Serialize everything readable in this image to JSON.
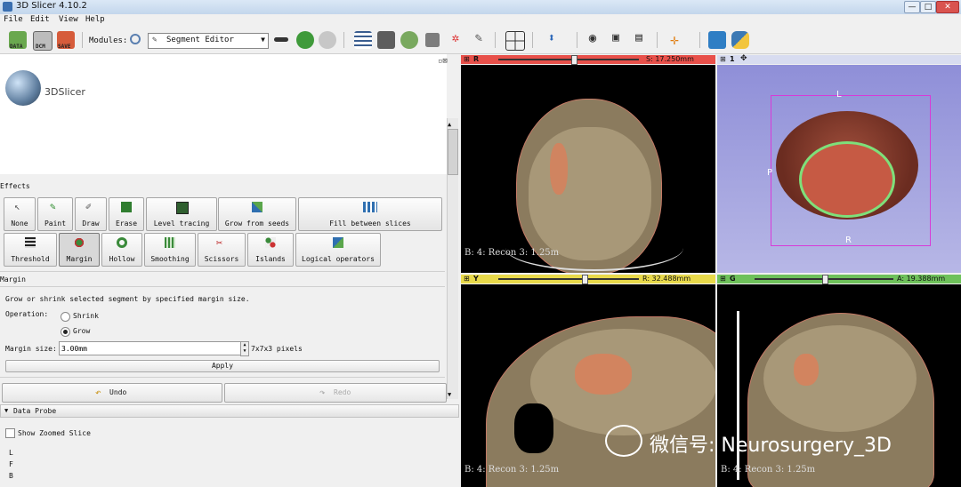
{
  "window": {
    "title": "3D Slicer 4.10.2",
    "controls": [
      "—",
      "□",
      "✕"
    ]
  },
  "menu": [
    "File",
    "Edit",
    "View",
    "Help"
  ],
  "toolbar": {
    "data_label": "DATA",
    "dcm_label": "DCM",
    "save_label": "SAVE",
    "modules_label": "Modules:",
    "module_selected": "Segment Editor"
  },
  "brand": {
    "name": "3DSlicer"
  },
  "effects": {
    "header": "Effects",
    "row1": [
      "None",
      "Paint",
      "Draw",
      "Erase",
      "Level tracing",
      "Grow from seeds",
      "Fill between slices"
    ],
    "row2": [
      "Threshold",
      "Margin",
      "Hollow",
      "Smoothing",
      "Scissors",
      "Islands",
      "Logical operators"
    ],
    "selected": "Margin"
  },
  "margin": {
    "header": "Margin",
    "description": "Grow or shrink selected segment by specified margin size.",
    "operation_label": "Operation:",
    "shrink_label": "Shrink",
    "grow_label": "Grow",
    "operation_value": "Grow",
    "size_label": "Margin size:",
    "size_value": "3.00mm",
    "pixels_text": "7x7x3 pixels",
    "apply_label": "Apply"
  },
  "history": {
    "undo_label": "Undo",
    "redo_label": "Redo"
  },
  "data_probe": {
    "header": "Data Probe",
    "show_zoomed_label": "Show Zoomed Slice",
    "lines": [
      "L",
      "F",
      "B"
    ]
  },
  "views": {
    "red": {
      "letter": "R",
      "offset": "S: 17.250mm",
      "bottom_label": "B: 4: Recon 3: 1.25m",
      "color": "#e8504a"
    },
    "green_3d": {
      "letter": "1",
      "orient": {
        "top": "L",
        "left": "P",
        "bottom": "R"
      },
      "color": "#6d6fd0"
    },
    "yellow": {
      "letter": "Y",
      "offset": "R: 32.488mm",
      "bottom_label": "B: 4: Recon 3: 1.25m",
      "color": "#e8d94a"
    },
    "green": {
      "letter": "G",
      "offset": "A: 19.388mm",
      "bottom_label": "B: 4: Recon 3: 1.25m",
      "color": "#6ec15a"
    }
  },
  "watermark": "微信号: Neurosurgery_3D"
}
